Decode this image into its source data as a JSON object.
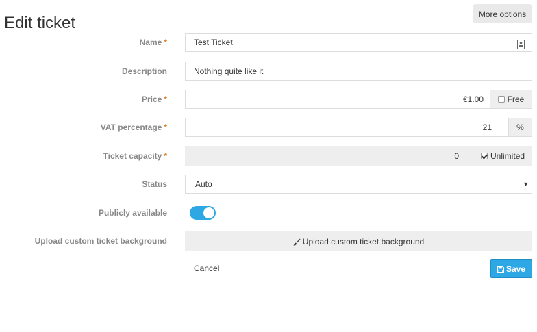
{
  "page": {
    "title": "Edit ticket",
    "more_options": "More options"
  },
  "form": {
    "required_marker": "*",
    "name": {
      "label": "Name",
      "value": "Test Ticket",
      "icon": "contact-card-icon"
    },
    "description": {
      "label": "Description",
      "value": "Nothing quite like it"
    },
    "price": {
      "label": "Price",
      "value": "€1.00",
      "free_label": "Free",
      "free_checked": false
    },
    "vat": {
      "label": "VAT percentage",
      "value": "21",
      "unit": "%"
    },
    "capacity": {
      "label": "Ticket capacity",
      "value": "0",
      "unlimited_label": "Unlimited",
      "unlimited_checked": true
    },
    "status": {
      "label": "Status",
      "selected": "Auto"
    },
    "public": {
      "label": "Publicly available",
      "enabled": true
    },
    "upload": {
      "label": "Upload custom ticket background",
      "button": "Upload custom ticket background",
      "icon": "brush-icon"
    }
  },
  "actions": {
    "cancel": "Cancel",
    "save": "Save",
    "save_icon": "floppy-disk-icon"
  },
  "colors": {
    "accent": "#2ea8e5",
    "required": "#e67e22",
    "label": "#888888",
    "disabled_bg": "#eeeeee"
  }
}
